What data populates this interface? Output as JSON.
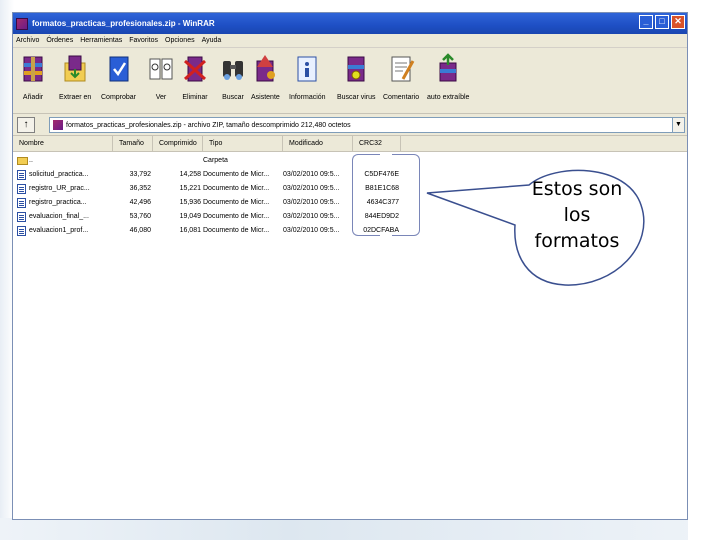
{
  "window": {
    "title": "formatos_practicas_profesionales.zip - WinRAR",
    "buttons": [
      "_",
      "□",
      "✕"
    ]
  },
  "menu": [
    "Archivo",
    "Órdenes",
    "Herramientas",
    "Favoritos",
    "Opciones",
    "Ayuda"
  ],
  "toolbar": [
    {
      "label": "Añadir",
      "icon": "add-archive-icon"
    },
    {
      "label": "Extraer en",
      "icon": "extract-to-icon"
    },
    {
      "label": "Comprobar",
      "icon": "test-icon"
    },
    {
      "label": "Ver",
      "icon": "view-icon"
    },
    {
      "label": "Eliminar",
      "icon": "delete-icon"
    },
    {
      "label": "Buscar",
      "icon": "find-icon"
    },
    {
      "label": "Asistente",
      "icon": "wizard-icon"
    },
    {
      "label": "Información",
      "icon": "info-icon"
    },
    {
      "label": "Buscar virus",
      "icon": "virus-scan-icon"
    },
    {
      "label": "Comentario",
      "icon": "comment-icon"
    },
    {
      "label": "auto extraíble",
      "icon": "sfx-icon"
    }
  ],
  "address": {
    "text": "formatos_practicas_profesionales.zip - archivo ZIP, tamaño descomprimido 212,480 octetos",
    "up_label": "↑"
  },
  "columns": [
    "Nombre",
    "Tamaño",
    "Comprimido",
    "Tipo",
    "Modificado",
    "CRC32"
  ],
  "files": [
    {
      "name": "..",
      "size": "",
      "packed": "",
      "type": "Carpeta",
      "modified": "",
      "crc": "",
      "folder": true
    },
    {
      "name": "solicitud_practica...",
      "size": "33,792",
      "packed": "14,258",
      "type": "Documento de Micr...",
      "modified": "03/02/2010 09:5...",
      "crc": "C5DF476E",
      "folder": false
    },
    {
      "name": "registro_UR_prac...",
      "size": "36,352",
      "packed": "15,221",
      "type": "Documento de Micr...",
      "modified": "03/02/2010 09:5...",
      "crc": "B81E1C68",
      "folder": false
    },
    {
      "name": "registro_practica...",
      "size": "42,496",
      "packed": "15,936",
      "type": "Documento de Micr...",
      "modified": "03/02/2010 09:5...",
      "crc": "4634C377",
      "folder": false
    },
    {
      "name": "evaluacion_final_...",
      "size": "53,760",
      "packed": "19,049",
      "type": "Documento de Micr...",
      "modified": "03/02/2010 09:5...",
      "crc": "844ED9D2",
      "folder": false
    },
    {
      "name": "evaluacion1_prof...",
      "size": "46,080",
      "packed": "16,081",
      "type": "Documento de Micr...",
      "modified": "03/02/2010 09:5...",
      "crc": "02DCFABA",
      "folder": false
    }
  ],
  "callout": {
    "line1": "Estos son",
    "line2": "los",
    "line3": "formatos",
    "fill": "#ffffff",
    "stroke": "#3a4f8f"
  },
  "colors": {
    "titlebar": "#1e4fc4",
    "chrome": "#ece9d8"
  }
}
